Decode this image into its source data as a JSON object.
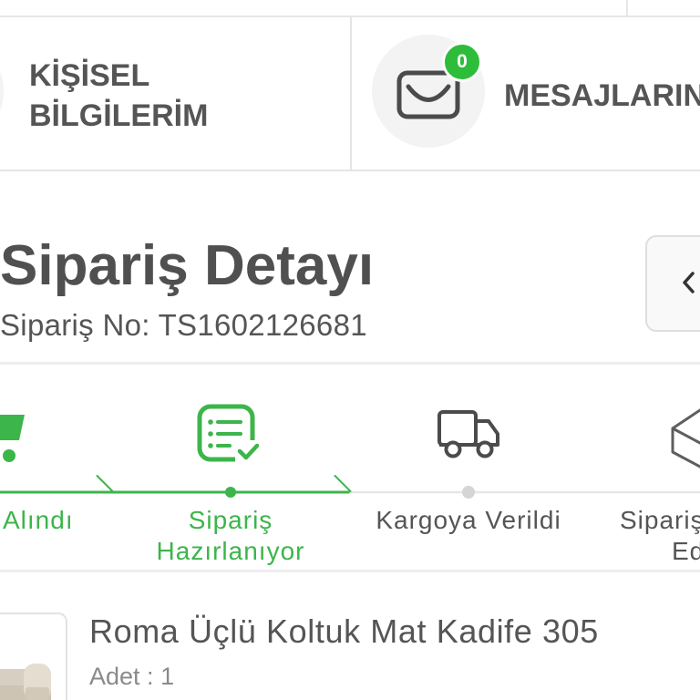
{
  "cards": {
    "personal": {
      "line1": "KİŞİSEL",
      "line2": "BİLGİLERİM",
      "icon": "profile-icon"
    },
    "messages": {
      "label": "MESAJLARIN",
      "badge_count": "0",
      "icon": "envelope-icon"
    }
  },
  "order": {
    "title": "Sipariş Detayı",
    "number_label": "Sipariş No:",
    "number": "TS1602126681",
    "back_icon": "chevron-left-icon"
  },
  "tracker": {
    "completed_steps": 2,
    "steps": [
      {
        "line1": "Alındı",
        "icon": "cart-icon"
      },
      {
        "line1": "Sipariş",
        "line2": "Hazırlanıyor",
        "icon": "checklist-icon"
      },
      {
        "line1": "Kargoya Verildi",
        "icon": "truck-icon"
      },
      {
        "line1": "Sipariş",
        "line2": "Ed",
        "icon": "box-icon"
      }
    ]
  },
  "product": {
    "name": "Roma Üçlü Koltuk Mat Kadife 305",
    "quantity_label": "Adet :",
    "quantity": "1"
  },
  "colors": {
    "accent": "#3cb54a",
    "badge": "#2dbd3a",
    "text": "#555555",
    "muted": "#8a8a8a",
    "pending_dot": "#d5d5d5",
    "pending_line": "#e6e6e6",
    "icon_gray": "#4b4b4b"
  }
}
